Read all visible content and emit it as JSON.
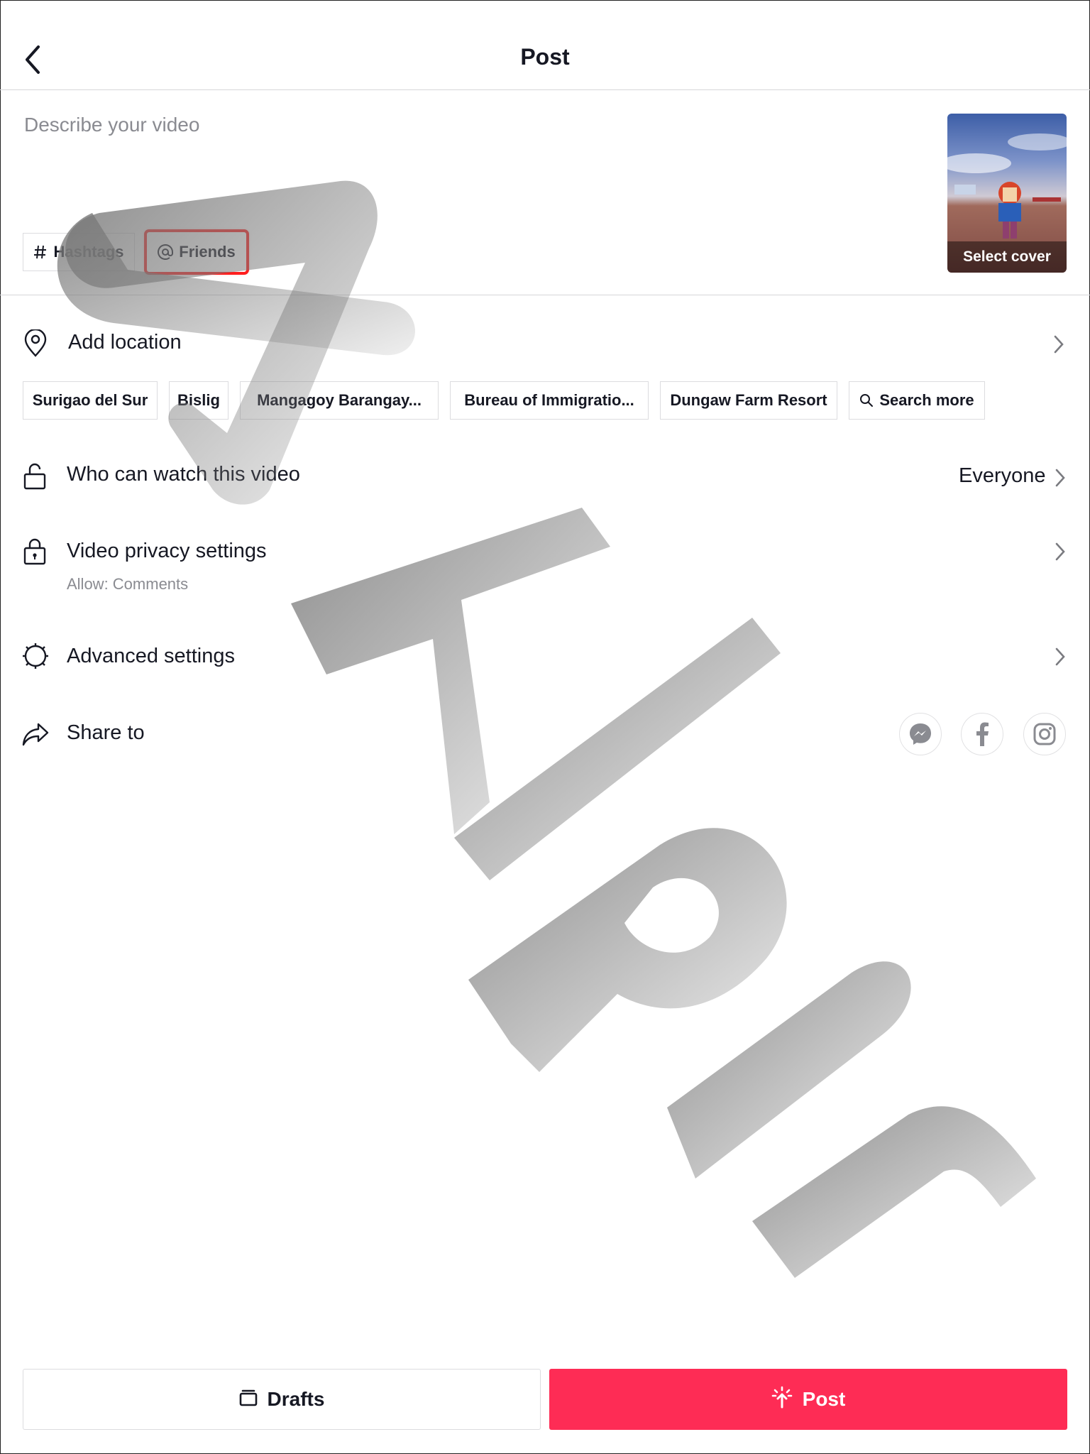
{
  "header": {
    "title": "Post",
    "back_icon": "chevron-left-icon"
  },
  "description": {
    "placeholder": "Describe your video"
  },
  "chips": {
    "hashtags": "Hashtags",
    "friends": "Friends"
  },
  "cover": {
    "label": "Select cover"
  },
  "location": {
    "label": "Add location",
    "suggestions": [
      "Surigao del Sur",
      "Bislig",
      "Mangagoy Barangay...",
      "Bureau of Immigratio...",
      "Dungaw Farm Resort"
    ],
    "search_more": "Search more"
  },
  "who_can_watch": {
    "label": "Who can watch this video",
    "value": "Everyone"
  },
  "privacy": {
    "label": "Video privacy settings",
    "sub": "Allow: Comments"
  },
  "advanced": {
    "label": "Advanced settings"
  },
  "share": {
    "label": "Share to",
    "targets": [
      "messenger-icon",
      "facebook-icon",
      "instagram-icon"
    ]
  },
  "footer": {
    "drafts": "Drafts",
    "post": "Post"
  },
  "colors": {
    "accent": "#fe2c55",
    "highlight": "#ff1d1d"
  }
}
